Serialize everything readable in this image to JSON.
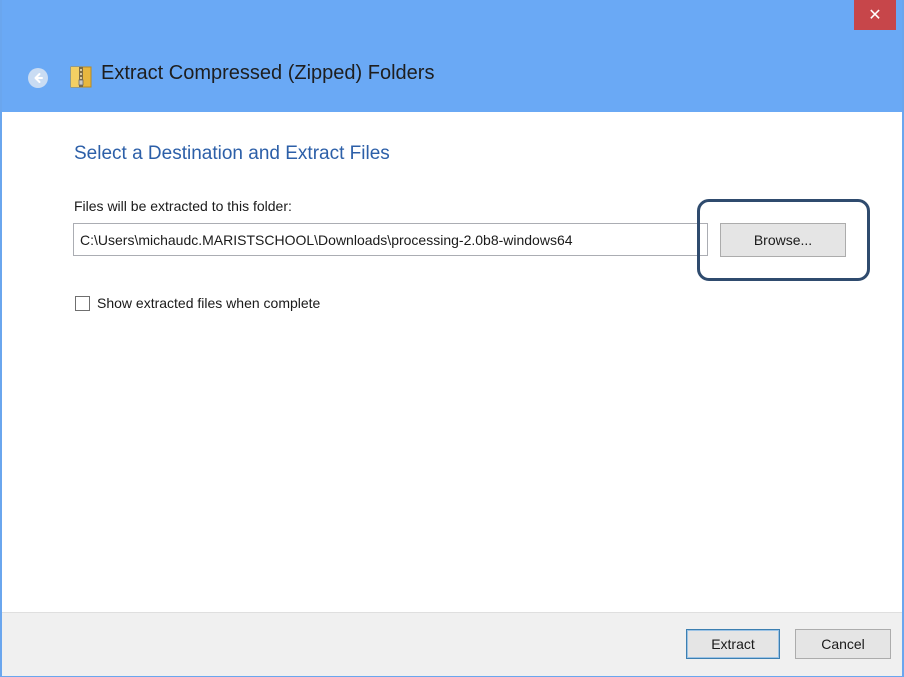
{
  "window": {
    "title": "Extract Compressed (Zipped) Folders",
    "close_label": "✕"
  },
  "content": {
    "heading": "Select a Destination and Extract Files",
    "folder_label": "Files will be extracted to this folder:",
    "path_value": "C:\\Users\\michaudc.MARISTSCHOOL\\Downloads\\processing-2.0b8-windows64",
    "browse_label": "Browse...",
    "show_files_label": "Show extracted files when complete",
    "show_files_checked": false
  },
  "footer": {
    "extract_label": "Extract",
    "cancel_label": "Cancel"
  },
  "icons": {
    "back": "back-arrow-icon",
    "zip": "zip-folder-icon",
    "close": "close-icon"
  },
  "colors": {
    "titlebar": "#6aa9f5",
    "close_button": "#c7464a",
    "heading": "#2c5fa8",
    "highlight_outline": "#2f4b6e"
  }
}
